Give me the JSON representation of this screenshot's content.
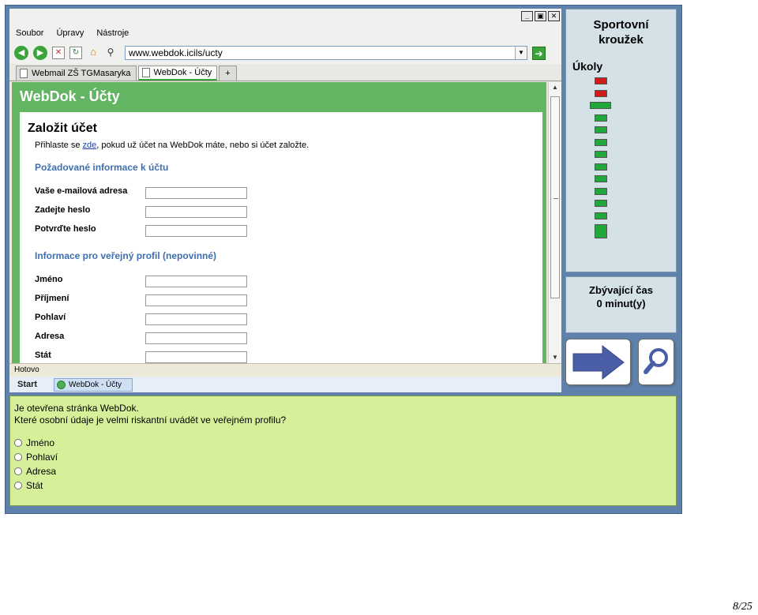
{
  "browser": {
    "menu": [
      "Soubor",
      "Úpravy",
      "Nástroje"
    ],
    "window_buttons": [
      "_",
      "▣",
      "✕"
    ],
    "url": "www.webdok.icils/ucty",
    "tabs": [
      {
        "label": "Webmail ZŠ TGMasaryka",
        "active": false
      },
      {
        "label": "WebDok - Účty",
        "active": true
      },
      {
        "label": "+",
        "active": false
      }
    ],
    "status": "Hotovo",
    "taskbar": {
      "start": "Start",
      "item": "WebDok - Účty"
    }
  },
  "page": {
    "title": "WebDok - Účty",
    "heading": "Založit účet",
    "intro_before": "Přihlaste se ",
    "intro_link": "zde",
    "intro_after": ", pokud už účet na WebDok máte, nebo si účet založte.",
    "section1": "Požadované informace k účtu",
    "section1_fields": [
      "Vaše e-mailová adresa",
      "Zadejte heslo",
      "Potvrďte heslo"
    ],
    "section2": "Informace pro veřejný profil (nepovinné)",
    "section2_fields": [
      "Jméno",
      "Příjmení",
      "Pohlaví",
      "Adresa",
      "Stát"
    ]
  },
  "side": {
    "title_line1": "Sportovní",
    "title_line2": "kroužek",
    "tasks_label": "Úkoly",
    "task_statuses": [
      "wrong",
      "wrong",
      "current",
      "pending",
      "pending",
      "pending",
      "pending",
      "pending",
      "pending",
      "pending",
      "pending",
      "pending",
      "last"
    ],
    "status_colors": {
      "wrong": "#d11a1a",
      "current": "#22a83a",
      "pending": "#22a83a",
      "last": "#22a83a"
    },
    "timer_label": "Zbývající čas",
    "timer_value": "0 minut(y)"
  },
  "question": {
    "line1": "Je otevřena stránka WebDok.",
    "line2": "Které osobní údaje je velmi riskantní uvádět ve veřejném profilu?",
    "options": [
      "Jméno",
      "Pohlaví",
      "Adresa",
      "Stát"
    ]
  },
  "page_number": "8/25"
}
